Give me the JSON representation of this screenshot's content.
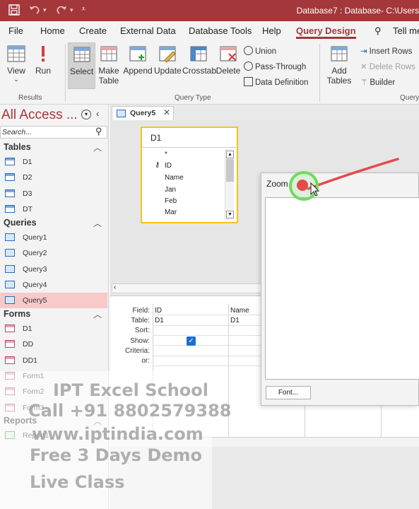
{
  "titlebar": {
    "title": "Database7 : Database- C:\\Users",
    "save_icon": "save-icon",
    "undo_icon": "undo-icon",
    "redo_icon": "redo-icon",
    "customize_icon": "customize-qat-icon"
  },
  "tabs": [
    "File",
    "Home",
    "Create",
    "External Data",
    "Database Tools",
    "Help",
    "Query Design"
  ],
  "tell_me": "Tell me",
  "ribbon": {
    "results": {
      "view": "View",
      "run": "Run",
      "label": "Results"
    },
    "query_type": {
      "select": "Select",
      "make_table_1": "Make",
      "make_table_2": "Table",
      "append": "Append",
      "update": "Update",
      "crosstab": "Crosstab",
      "delete": "Delete",
      "union": "Union",
      "pass_through": "Pass-Through",
      "data_definition": "Data Definition",
      "label": "Query Type"
    },
    "query_setup": {
      "add_tables_1": "Add",
      "add_tables_2": "Tables",
      "insert_rows": "Insert Rows",
      "delete_rows": "Delete Rows",
      "builder": "Builder",
      "label": "Query"
    }
  },
  "nav": {
    "title": "All Access ...",
    "search_placeholder": "Search...",
    "sections": [
      {
        "name": "Tables",
        "items": [
          "D1",
          "D2",
          "D3",
          "DT"
        ]
      },
      {
        "name": "Queries",
        "items": [
          "Query1",
          "Query2",
          "Query3",
          "Query4",
          "Query5"
        ]
      },
      {
        "name": "Forms",
        "items": [
          "D1",
          "DD",
          "DD1",
          "Form1",
          "Form2",
          "Form3"
        ]
      },
      {
        "name": "Reports",
        "items": [
          "Report1"
        ]
      }
    ],
    "active": "Query5"
  },
  "doc": {
    "tab": "Query5",
    "table_name": "D1",
    "fields": [
      "*",
      "ID",
      "Name",
      "Jan",
      "Feb",
      "Mar"
    ],
    "grid": {
      "row_labels": [
        "Field:",
        "Table:",
        "Sort:",
        "Show:",
        "Criteria:",
        "or:"
      ],
      "columns": [
        {
          "field": "ID",
          "table": "D1",
          "show": true
        },
        {
          "field": "Name",
          "table": "D1",
          "show": true
        }
      ]
    }
  },
  "zoom": {
    "title": "Zoom",
    "font_button": "Font..."
  },
  "watermark": [
    "IPT Excel School",
    "Call +91 8802579388",
    "www.iptindia.com",
    "Free 3 Days Demo",
    "Live Class"
  ],
  "colors": {
    "accent": "#a4373a",
    "selected_table_border": "#f5c518",
    "active_nav": "#f8c9c9"
  }
}
